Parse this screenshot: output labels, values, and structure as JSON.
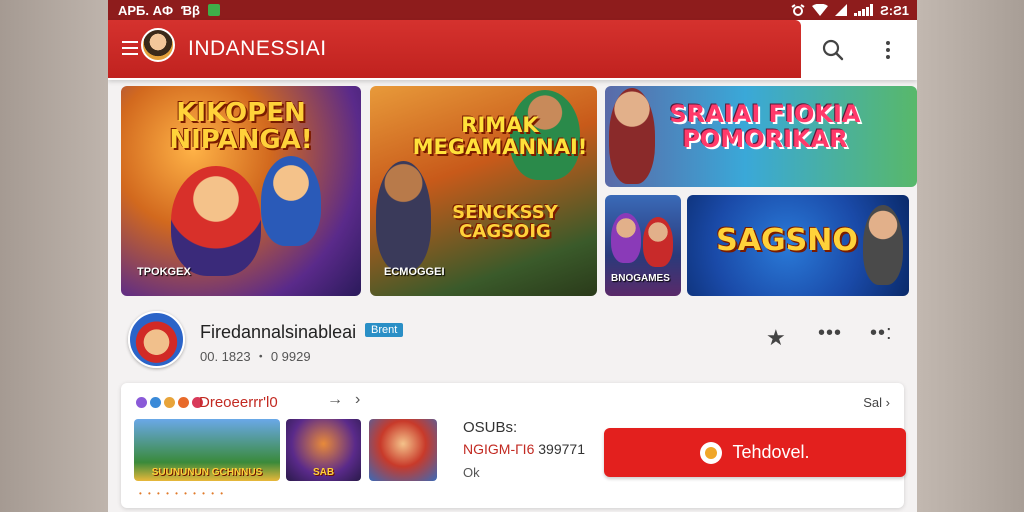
{
  "statusbar": {
    "left_text": "APБ. AФ",
    "left_text2": "Ɓβ",
    "time": "Ƨ:Ƨ1"
  },
  "appbar": {
    "title": "INDANESSIAI",
    "menu_icon": "hamburger-menu-icon",
    "search_icon": "search-icon",
    "more_icon": "more-vertical-icon"
  },
  "banners": [
    {
      "title": "KIKOPEN NIPANGA!",
      "subtitle": "TPOKGEX"
    },
    {
      "title": "RIMAK MEGAMANNAI!",
      "title2": "SENCKSSY CAGSOIG",
      "subtitle": "ECMOGGEI"
    },
    {
      "title": "SRAIAI FIOKIA POMORIKAR"
    },
    {
      "subtitle": "BNOGAMES"
    },
    {
      "title": "SAGSNO"
    }
  ],
  "developer": {
    "name": "Firedannalsinableai",
    "badge": "Brent",
    "stats": "00. 1823 ・ 0 9929"
  },
  "card": {
    "label": "Dreoeerrr'l0",
    "see_all": "Sal",
    "thumbs": [
      {
        "text": "SUUNUNUN GCHNNUS"
      },
      {
        "text": "SAB"
      },
      {
        "text": ""
      }
    ],
    "meta1": "OSUBs:",
    "meta2_red": "NGIGM-ГІ6",
    "meta2_rest": " 399771",
    "meta3": "Ok",
    "install_label": "Tehdovel."
  },
  "colors": {
    "brand_red": "#c0221f",
    "install_red": "#e3201e",
    "badge_blue": "#2a8fc6"
  }
}
